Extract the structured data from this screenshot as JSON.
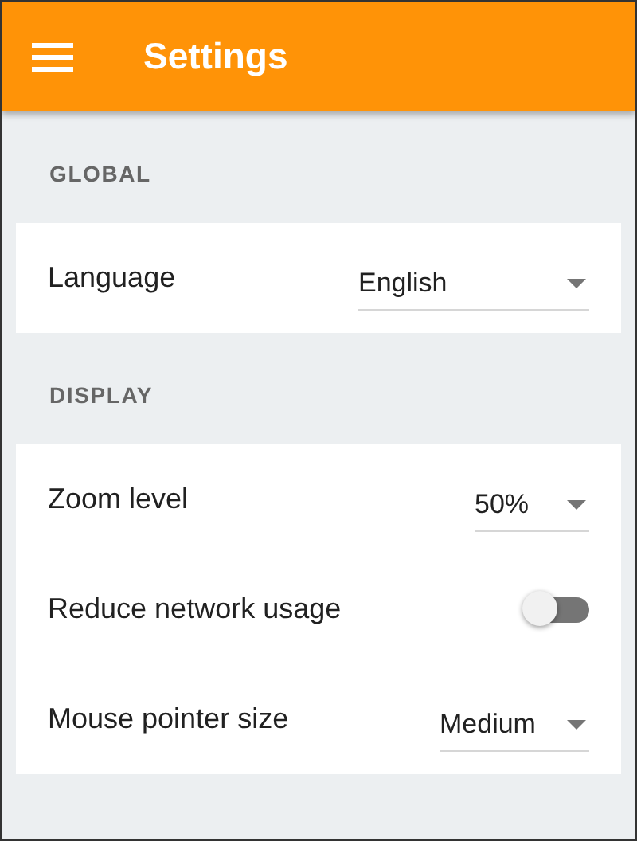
{
  "app_bar": {
    "title": "Settings"
  },
  "sections": [
    {
      "heading": "GLOBAL",
      "items": [
        {
          "kind": "select",
          "label": "Language",
          "value": "English"
        }
      ]
    },
    {
      "heading": "DISPLAY",
      "items": [
        {
          "kind": "select",
          "label": "Zoom level",
          "value": "50%"
        },
        {
          "kind": "toggle",
          "label": "Reduce network usage",
          "on": false
        },
        {
          "kind": "select",
          "label": "Mouse pointer size",
          "value": "Medium"
        }
      ]
    }
  ]
}
